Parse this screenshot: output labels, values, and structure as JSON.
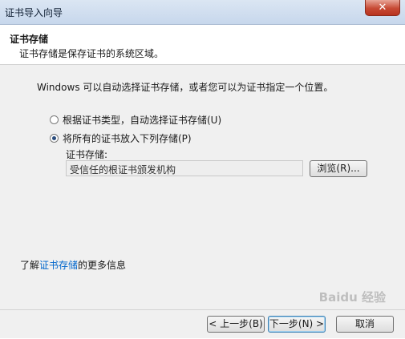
{
  "window": {
    "title": "证书导入向导",
    "close_glyph": "✕"
  },
  "header": {
    "title": "证书存储",
    "subtitle": "证书存储是保存证书的系统区域。"
  },
  "content": {
    "intro": "Windows 可以自动选择证书存储，或者您可以为证书指定一个位置。",
    "radio_options": [
      {
        "label": "根据证书类型，自动选择证书存储(U)",
        "checked": false
      },
      {
        "label": "将所有的证书放入下列存储(P)",
        "checked": true
      }
    ],
    "store_label": "证书存储:",
    "store_value": "受信任的根证书颁发机构",
    "browse_label": "浏览(R)...",
    "more_info_prefix": "了解",
    "more_info_link": "证书存储",
    "more_info_suffix": "的更多信息"
  },
  "footer": {
    "back_label": "< 上一步(B)",
    "next_label": "下一步(N) >",
    "cancel_label": "取消"
  },
  "watermark": "Baidu 经验"
}
